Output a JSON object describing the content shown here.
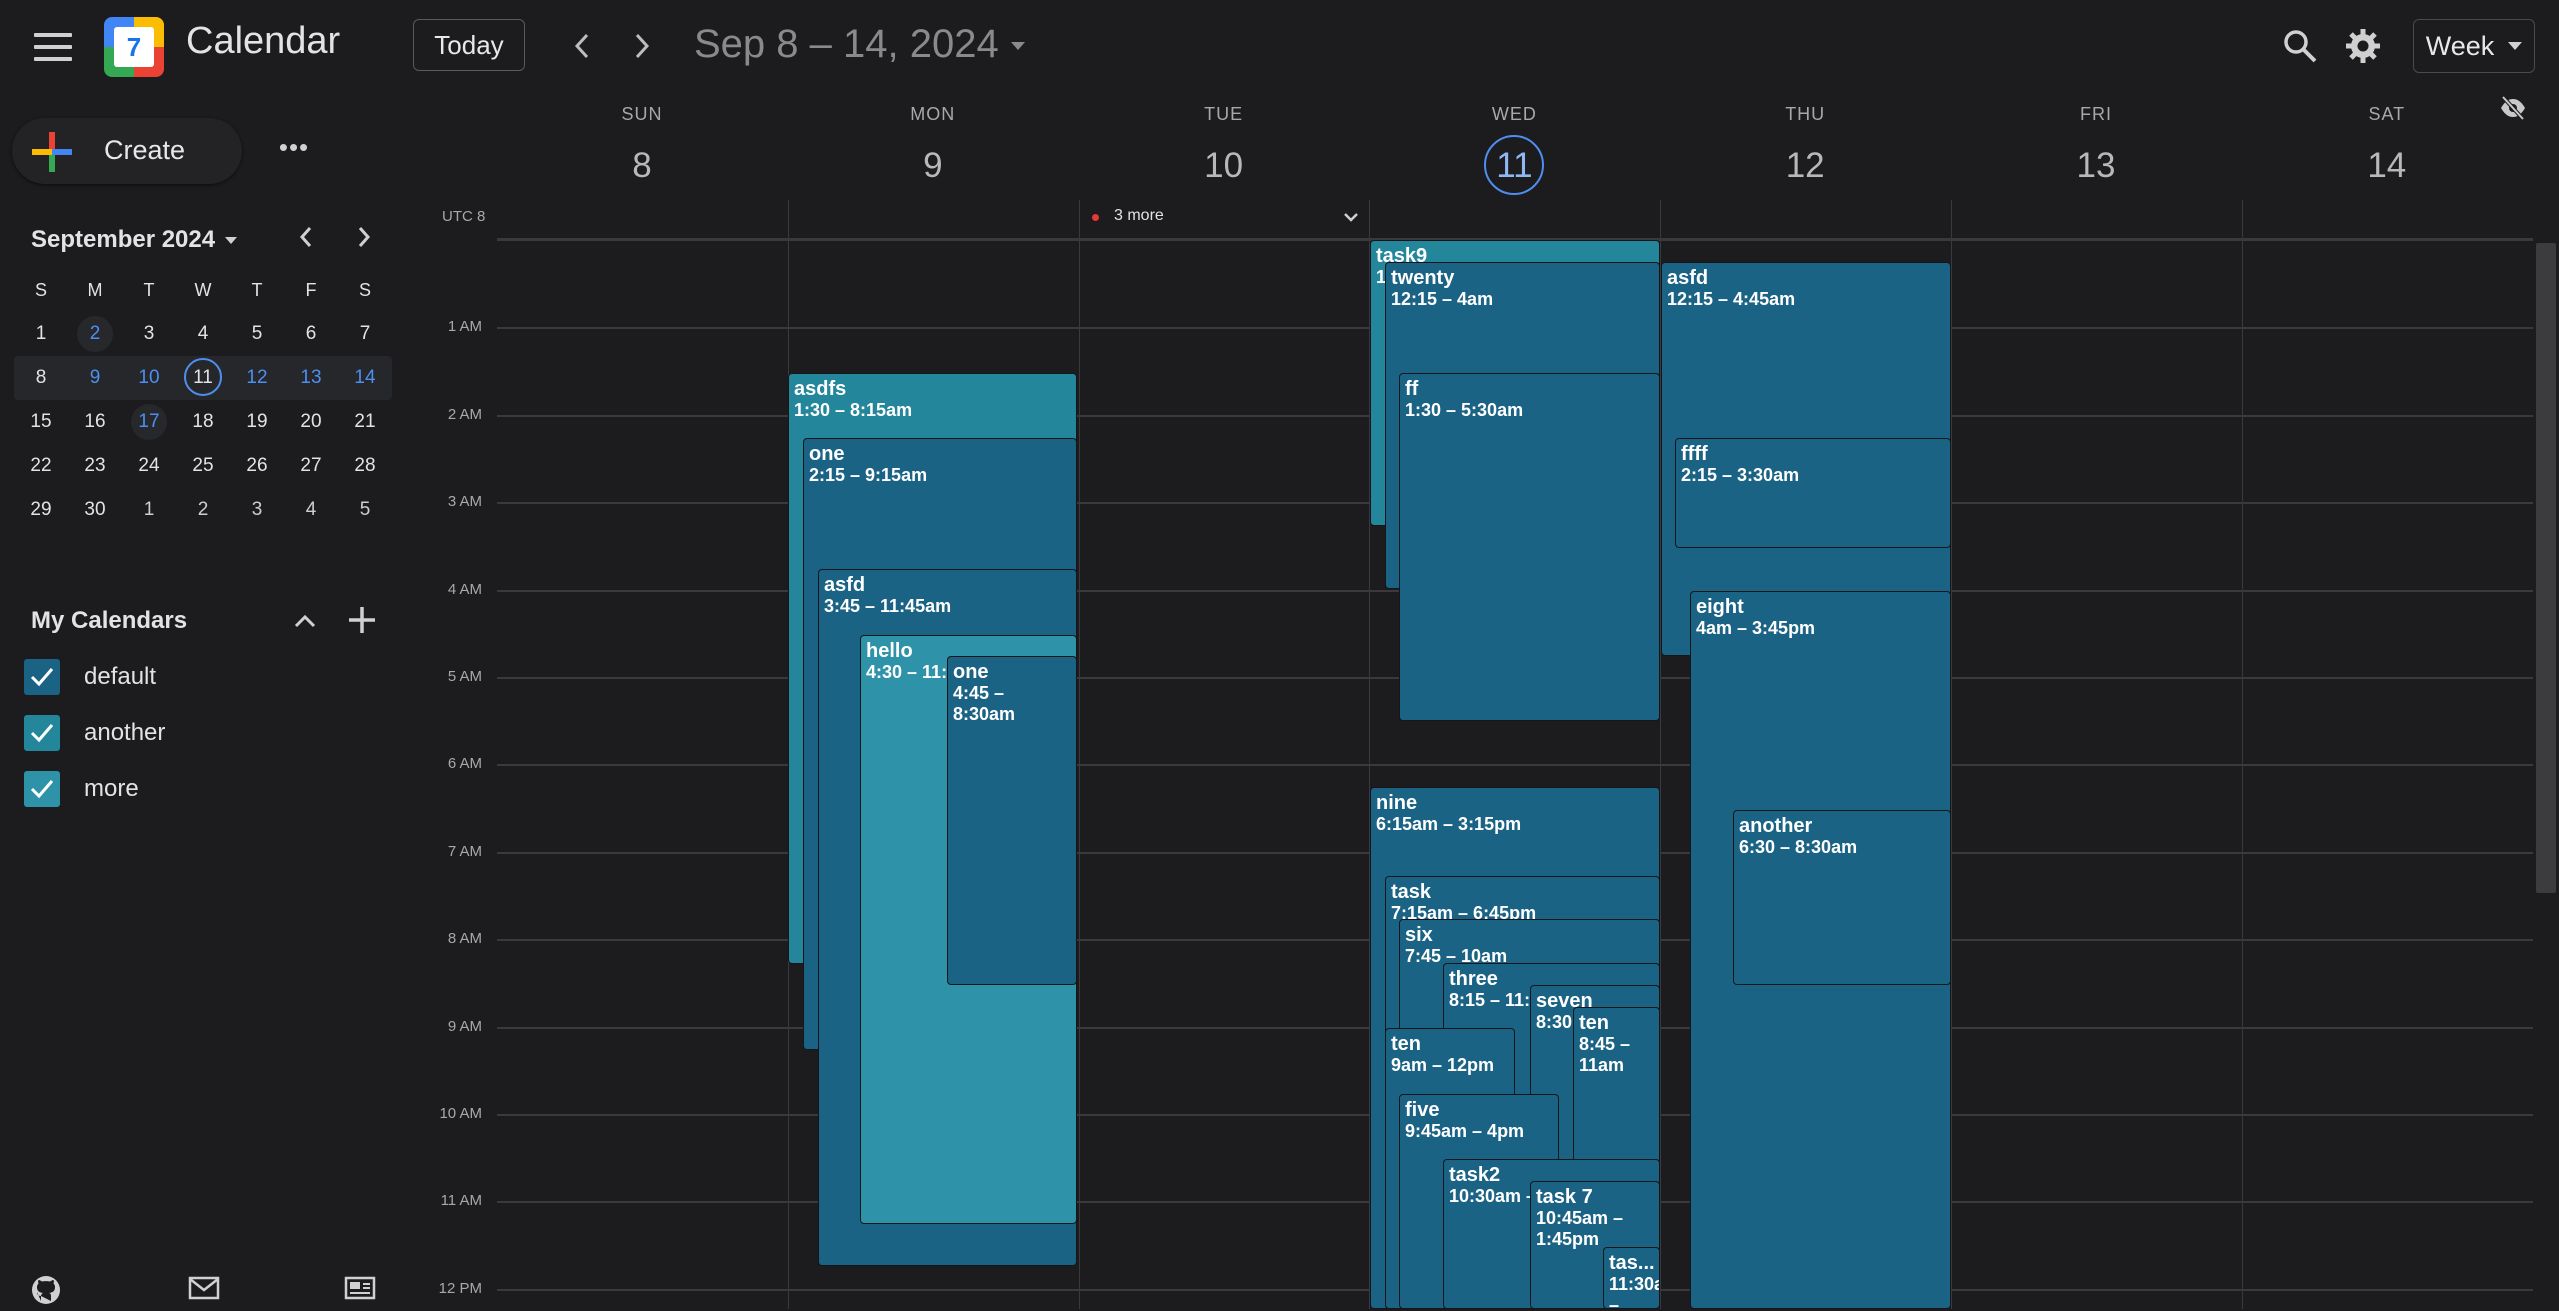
{
  "header": {
    "app_title": "Calendar",
    "logo_day": "7",
    "today_label": "Today",
    "date_range": "Sep 8 – 14, 2024",
    "view_label": "Week",
    "icons": [
      "menu-icon",
      "search-icon",
      "gear-icon"
    ]
  },
  "sidebar": {
    "create_label": "Create",
    "more_label": "•••",
    "mini_calendar": {
      "title": "September 2024",
      "weekdays": [
        "S",
        "M",
        "T",
        "W",
        "T",
        "F",
        "S"
      ],
      "weeks": [
        [
          "1",
          "2",
          "3",
          "4",
          "5",
          "6",
          "7"
        ],
        [
          "8",
          "9",
          "10",
          "11",
          "12",
          "13",
          "14"
        ],
        [
          "15",
          "16",
          "17",
          "18",
          "19",
          "20",
          "21"
        ],
        [
          "22",
          "23",
          "24",
          "25",
          "26",
          "27",
          "28"
        ],
        [
          "29",
          "30",
          "1",
          "2",
          "3",
          "4",
          "5"
        ]
      ],
      "today": "11"
    },
    "my_calendars_title": "My Calendars",
    "calendars": [
      {
        "name": "default",
        "color": "#1b6385",
        "checked": true
      },
      {
        "name": "another",
        "color": "#24869b",
        "checked": true
      },
      {
        "name": "more",
        "color": "#2e93a8",
        "checked": true
      }
    ],
    "footer_icons": [
      "github-icon",
      "mail-icon",
      "newspaper-icon"
    ]
  },
  "week": {
    "days": [
      {
        "name": "SUN",
        "num": "8"
      },
      {
        "name": "MON",
        "num": "9"
      },
      {
        "name": "TUE",
        "num": "10"
      },
      {
        "name": "WED",
        "num": "11",
        "today": true
      },
      {
        "name": "THU",
        "num": "12"
      },
      {
        "name": "FRI",
        "num": "13"
      },
      {
        "name": "SAT",
        "num": "14"
      }
    ],
    "timezone": "UTC 8",
    "all_day_more": "3 more",
    "hours": [
      "1 AM",
      "2 AM",
      "3 AM",
      "4 AM",
      "5 AM",
      "6 AM",
      "7 AM",
      "8 AM",
      "9 AM",
      "10 AM",
      "11 AM",
      "12 PM"
    ]
  },
  "events": [
    {
      "title": "asdfs",
      "time": "1:30 – 8:15am",
      "calendar": "another"
    },
    {
      "title": "one",
      "time": "2:15 – 9:15am",
      "calendar": "default"
    },
    {
      "title": "asfd",
      "time": "3:45 – 11:45am",
      "calendar": "default"
    },
    {
      "title": "hello",
      "time": "4:30 – 11:",
      "calendar": "more"
    },
    {
      "title": "one",
      "time": "4:45 – 8:30am",
      "calendar": "default"
    },
    {
      "title": "task9",
      "time": "1",
      "calendar": "another"
    },
    {
      "title": "twenty",
      "time": "12:15 – 4am",
      "calendar": "default"
    },
    {
      "title": "ff",
      "time": "1:30 – 5:30am",
      "calendar": "default"
    },
    {
      "title": "nine",
      "time": "6:15am – 3:15pm",
      "calendar": "default"
    },
    {
      "title": "task",
      "time": "7:15am – 6:45pm",
      "calendar": "default"
    },
    {
      "title": "six",
      "time": "7:45 – 10am",
      "calendar": "default"
    },
    {
      "title": "three",
      "time": "8:15 – 11:",
      "calendar": "default"
    },
    {
      "title": "seven",
      "time": "8:30 2:15p",
      "calendar": "default"
    },
    {
      "title": "ten",
      "time": "8:45 – 11am",
      "calendar": "default"
    },
    {
      "title": "ten",
      "time": "9am – 12pm",
      "calendar": "default"
    },
    {
      "title": "five",
      "time": "9:45am – 4pm",
      "calendar": "default"
    },
    {
      "title": "task2",
      "time": "10:30am –",
      "calendar": "default"
    },
    {
      "title": "task 7",
      "time": "10:45am – 1:45pm",
      "calendar": "default"
    },
    {
      "title": "tas...",
      "time": "11:30a –",
      "calendar": "default"
    },
    {
      "title": "asfd",
      "time": "12:15 – 4:45am",
      "calendar": "default"
    },
    {
      "title": "ffff",
      "time": "2:15 – 3:30am",
      "calendar": "default"
    },
    {
      "title": "eight",
      "time": "4am – 3:45pm",
      "calendar": "default"
    },
    {
      "title": "another",
      "time": "6:30 – 8:30am",
      "calendar": "default"
    }
  ]
}
